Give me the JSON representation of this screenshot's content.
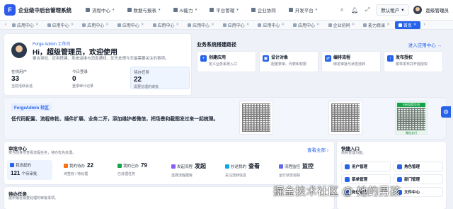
{
  "app": {
    "title": "企业级中后台管理系统",
    "logo": "F"
  },
  "nav": [
    {
      "label": "流程中心",
      "icon": "flow-icon"
    },
    {
      "label": "数据与报表",
      "icon": "chart-icon"
    },
    {
      "label": "AI能力",
      "icon": "ai-icon"
    },
    {
      "label": "平台管理",
      "icon": "platform-icon"
    },
    {
      "label": "企业协同",
      "icon": "team-icon"
    },
    {
      "label": "开发平台",
      "icon": "code-icon"
    }
  ],
  "header": {
    "tenant": "默认租户",
    "username": "超级管理员"
  },
  "tabs": [
    "应用中心",
    "应用中心",
    "应用中心",
    "应用中心",
    "应用中心",
    "应用中心",
    "应用中心",
    "应用中心",
    "应用中心",
    "企业协同",
    "能力目录",
    "首页"
  ],
  "welcome": {
    "workspace": "Forge Admin 工作台",
    "greeting": "Hi，超级管理员，欢迎使用",
    "desc": "聚合审批、应用搭建、系统运维与消息通知，优先处理今天最需要关注的事项。",
    "stats": [
      {
        "label": "在线用户",
        "value": "33",
        "sub": "当前活跃会话"
      },
      {
        "label": "今日登录",
        "value": "0",
        "sub": "登录审计记录"
      },
      {
        "label": "待办任务",
        "value": "22",
        "sub": "需要处理的审批"
      }
    ]
  },
  "quickpath": {
    "title": "业务系统搭建路径",
    "link": "进入应用中心 →",
    "items": [
      {
        "title": "创建应用",
        "desc": "定义业务系统入口"
      },
      {
        "title": "设计对象",
        "desc": "配置表单、列表和权限"
      },
      {
        "title": "编排流程",
        "desc": "绑定审批与状态流转"
      },
      {
        "title": "发布授权",
        "desc": "菜单发布并开放授权"
      }
    ]
  },
  "community": {
    "badge": "ForgeAdmin 社区",
    "text": "低代码配置、流程审批、插件扩展、业务二开，添加维护者微信，把场景和截图发过来一起梳理。",
    "qr_green_title": "扫码加群交流",
    "qr_green_foot": "微信支付"
  },
  "approval": {
    "title": "审批中心",
    "sub": "按当前身份查看流程任务，待办优先处理。",
    "view_all": "查看全部 ›",
    "items": [
      {
        "label": "我发起的",
        "value": "121",
        "sub": "个待审批",
        "color": "#2563eb"
      },
      {
        "label": "我的待办",
        "value": "22",
        "sub": "待签收 / 待处理",
        "color": "#f97316"
      },
      {
        "label": "我的已办",
        "value": "79",
        "sub": "已处理任务",
        "color": "#16a34a"
      },
      {
        "label": "发起流程",
        "value": "发起",
        "sub": "选择流程模板",
        "color": "#8b5cf6"
      },
      {
        "label": "抄送我的",
        "value": "查看",
        "sub": "关注流转信息",
        "color": "#0ea5e9"
      },
      {
        "label": "流程监控",
        "value": "监控",
        "sub": "运行状态追踪",
        "color": "#6366f1"
      }
    ]
  },
  "quick": {
    "title": "快捷入口",
    "sub": "高频管理功能。",
    "items": [
      "用户管理",
      "角色管理",
      "菜单管理",
      "部门管理",
      "岗位管理",
      "文件中心"
    ]
  },
  "todo": {
    "title": "待办任务",
    "sub": "展示最近需要处理的审批事项。"
  },
  "watermark": "掘金技术社区 @ 她的男孩"
}
